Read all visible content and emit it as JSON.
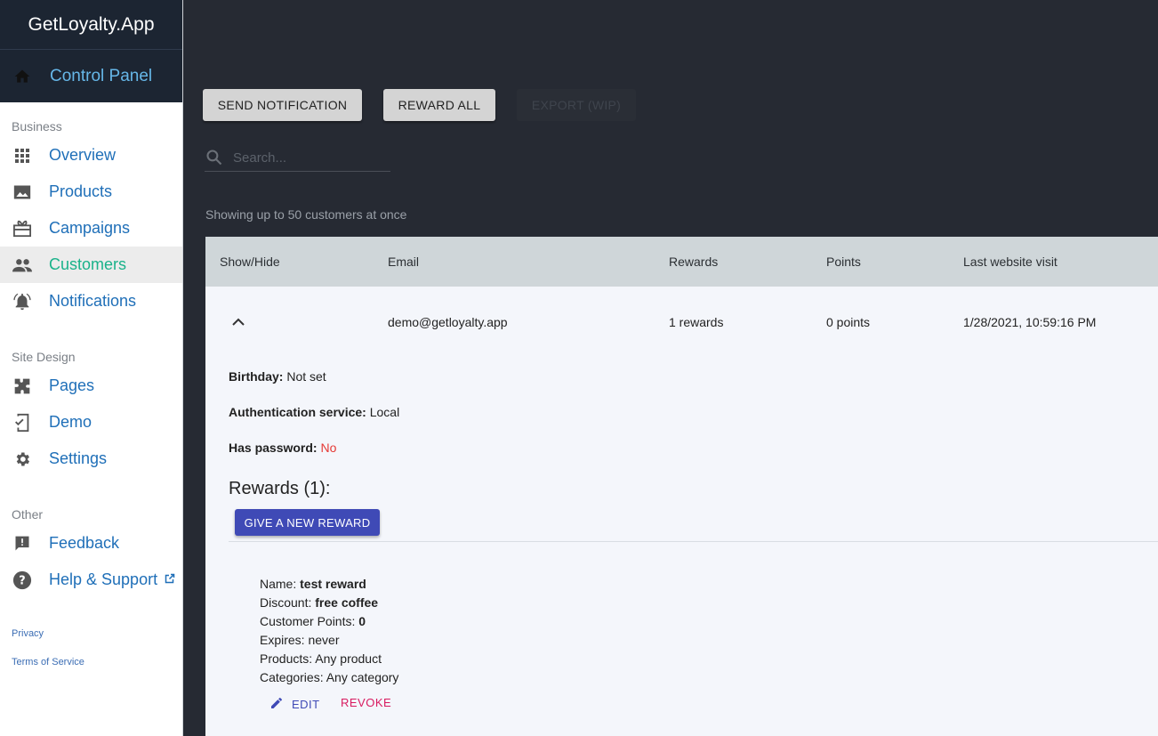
{
  "sidebar": {
    "brand": "GetLoyalty.App",
    "control_panel": "Control Panel",
    "sections": {
      "business": "Business",
      "site_design": "Site Design",
      "other": "Other"
    },
    "items": {
      "overview": "Overview",
      "products": "Products",
      "campaigns": "Campaigns",
      "customers": "Customers",
      "notifications": "Notifications",
      "pages": "Pages",
      "demo": "Demo",
      "settings": "Settings",
      "feedback": "Feedback",
      "help": "Help & Support"
    },
    "footer": {
      "privacy": "Privacy",
      "terms": "Terms of Service"
    },
    "active_item": "customers"
  },
  "toolbar": {
    "send_notification": "SEND NOTIFICATION",
    "reward_all": "REWARD ALL",
    "export": "EXPORT (WIP)"
  },
  "search": {
    "placeholder": "Search..."
  },
  "hint": "Showing up to 50 customers at once",
  "table": {
    "columns": [
      "Show/Hide",
      "Email",
      "Rewards",
      "Points",
      "Last website visit"
    ],
    "rows": [
      {
        "email": "demo@getloyalty.app",
        "rewards": "1 rewards",
        "points": "0 points",
        "last_visit": "1/28/2021, 10:59:16 PM"
      }
    ]
  },
  "detail": {
    "birthday_label": "Birthday:",
    "birthday_value": "Not set",
    "auth_label": "Authentication service:",
    "auth_value": "Local",
    "password_label": "Has password:",
    "password_value": "No",
    "rewards_title": "Rewards (1):",
    "give_reward": "GIVE A NEW REWARD",
    "reward": {
      "name_label": "Name:",
      "name_value": "test reward",
      "discount_label": "Discount:",
      "discount_value": "free coffee",
      "points_label": "Customer Points:",
      "points_value": "0",
      "expires_label": "Expires:",
      "expires_value": "never",
      "products_label": "Products:",
      "products_value": "Any product",
      "categories_label": "Categories:",
      "categories_value": "Any category"
    },
    "edit": "EDIT",
    "revoke": "REVOKE"
  },
  "colors": {
    "sidebar_header": "#1c2532",
    "main_bg": "#262a33",
    "link": "#1f6fb8",
    "active": "#1ab28a",
    "accent_button": "#3f4ab6",
    "danger": "#e53935",
    "revoke": "#d81b60"
  }
}
